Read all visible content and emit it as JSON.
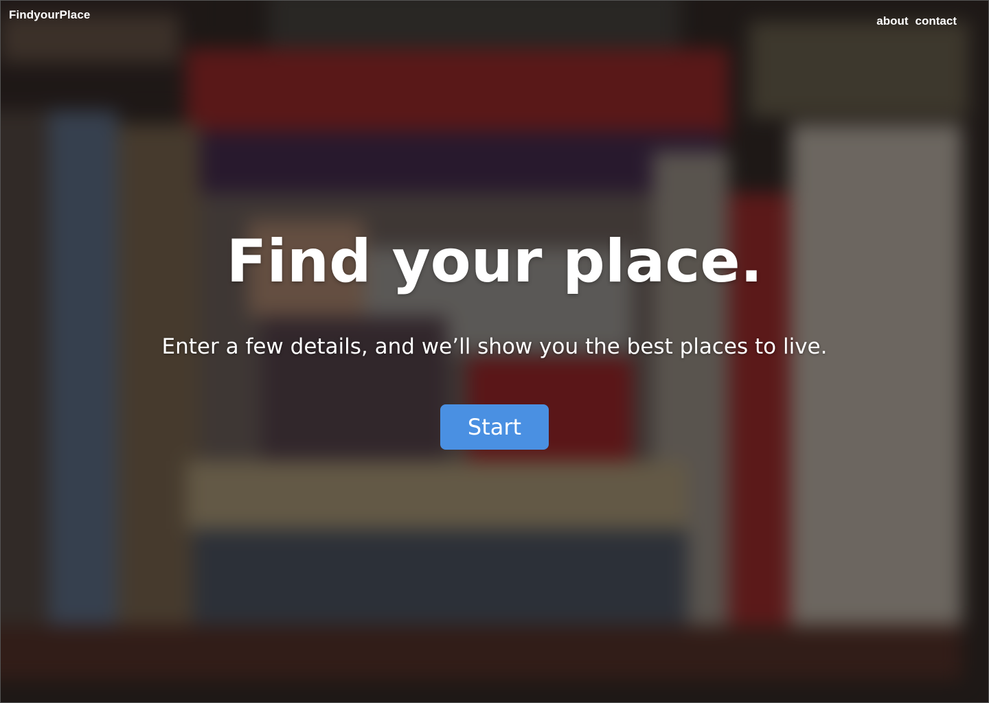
{
  "header": {
    "brand": "FindyourPlace",
    "nav": [
      {
        "label": "about"
      },
      {
        "label": "contact"
      }
    ]
  },
  "hero": {
    "title": "Find your place.",
    "subtitle": "Enter a few details, and we’ll show you the best places to live.",
    "cta_label": "Start"
  },
  "colors": {
    "accent": "#4a90e2",
    "text": "#ffffff",
    "overlay": "#0a0808"
  }
}
